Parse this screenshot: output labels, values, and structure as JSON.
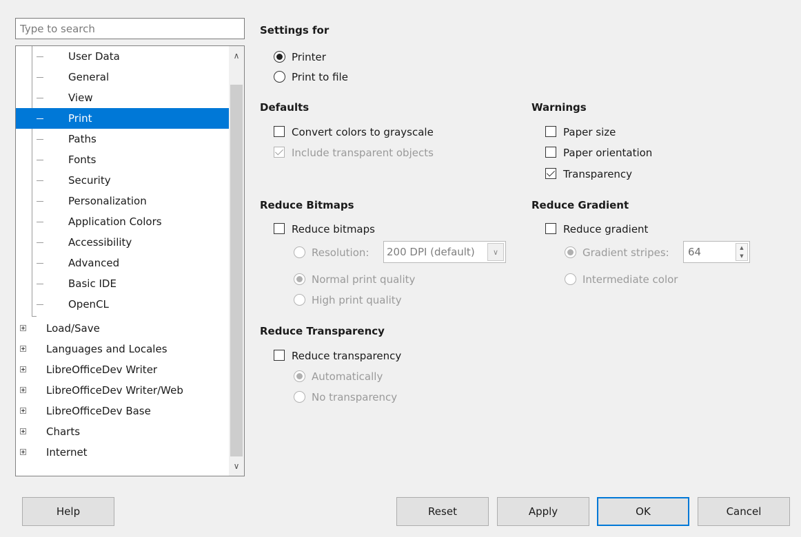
{
  "search": {
    "placeholder": "Type to search"
  },
  "tree": {
    "children": [
      "User Data",
      "General",
      "View",
      "Print",
      "Paths",
      "Fonts",
      "Security",
      "Personalization",
      "Application Colors",
      "Accessibility",
      "Advanced",
      "Basic IDE",
      "OpenCL"
    ],
    "selected": "Print",
    "top_level": [
      "Load/Save",
      "Languages and Locales",
      "LibreOfficeDev Writer",
      "LibreOfficeDev Writer/Web",
      "LibreOfficeDev Base",
      "Charts",
      "Internet"
    ]
  },
  "settings_for": {
    "heading": "Settings for",
    "printer": "Printer",
    "print_to_file": "Print to file"
  },
  "defaults": {
    "heading": "Defaults",
    "convert_grayscale": "Convert colors to grayscale",
    "include_transparent": "Include transparent objects"
  },
  "warnings": {
    "heading": "Warnings",
    "paper_size": "Paper size",
    "paper_orientation": "Paper orientation",
    "transparency": "Transparency"
  },
  "reduce_bitmaps": {
    "heading": "Reduce Bitmaps",
    "reduce": "Reduce bitmaps",
    "resolution": "Resolution:",
    "resolution_value": "200 DPI (default)",
    "normal_quality": "Normal print quality",
    "high_quality": "High print quality"
  },
  "reduce_gradient": {
    "heading": "Reduce Gradient",
    "reduce": "Reduce gradient",
    "stripes": "Gradient stripes:",
    "stripes_value": "64",
    "intermediate": "Intermediate color"
  },
  "reduce_transparency": {
    "heading": "Reduce Transparency",
    "reduce": "Reduce transparency",
    "automatically": "Automatically",
    "no_transparency": "No transparency"
  },
  "buttons": {
    "help": "Help",
    "reset": "Reset",
    "apply": "Apply",
    "ok": "OK",
    "cancel": "Cancel"
  }
}
